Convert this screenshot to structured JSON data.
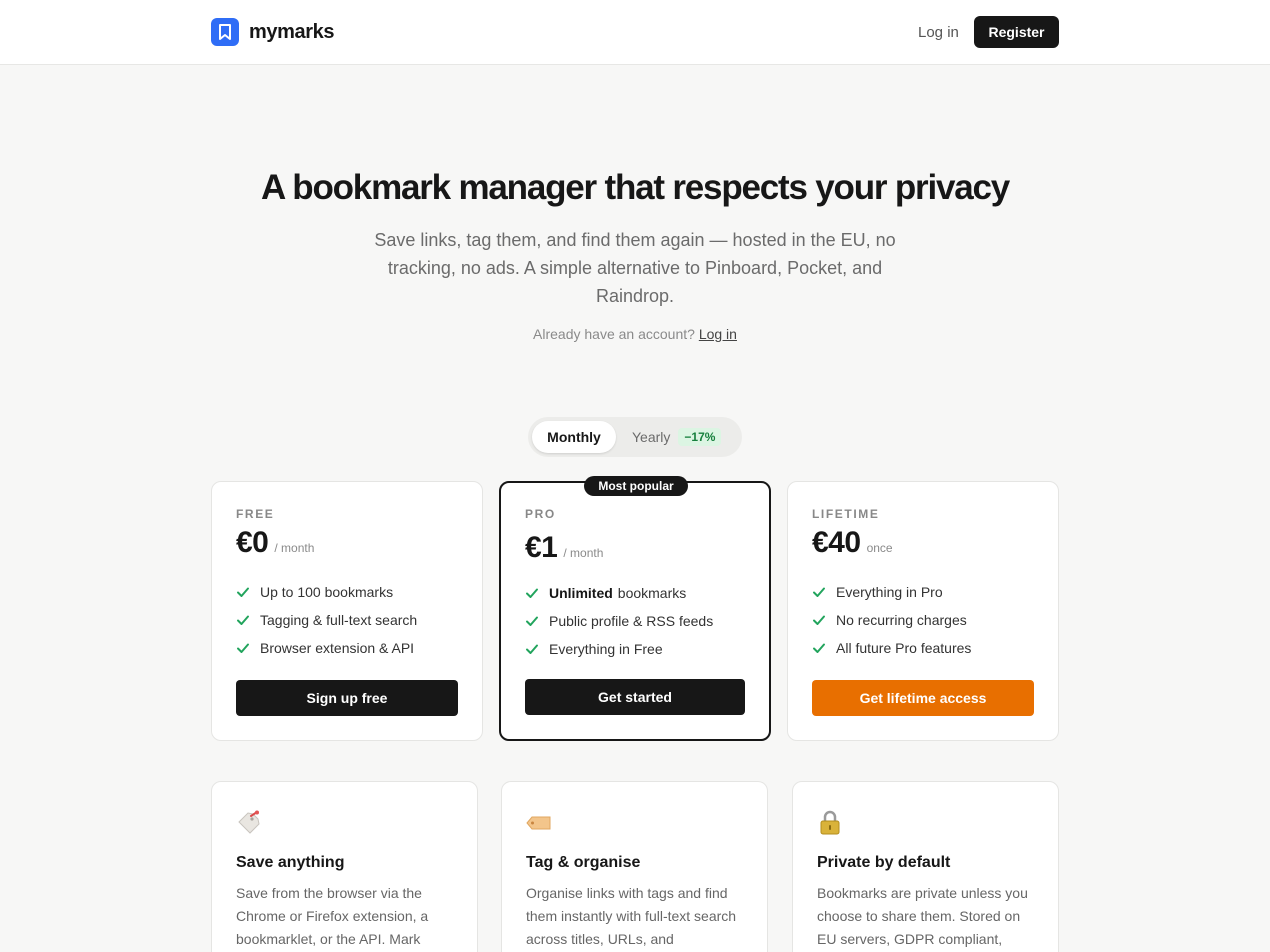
{
  "header": {
    "brand": "mymarks",
    "login_label": "Log in",
    "register_label": "Register"
  },
  "hero": {
    "title": "A bookmark manager that respects your privacy",
    "subtitle": "Save links, tag them, and find them again — hosted in the EU, no tracking, no ads. A simple alternative to Pinboard, Pocket, and Raindrop.",
    "account_prompt": "Already have an account?",
    "account_link": "Log in"
  },
  "billing": {
    "monthly_label": "Monthly",
    "yearly_label": "Yearly",
    "yearly_discount": "−17%",
    "selected": "Monthly"
  },
  "plans": [
    {
      "name": "FREE",
      "price": "€0",
      "period": "/ month",
      "features": [
        "Up to 100 bookmarks",
        "Tagging & full-text search",
        "Browser extension & API"
      ],
      "cta": "Sign up free"
    },
    {
      "name": "PRO",
      "badge": "Most popular",
      "price": "€1",
      "period": "/ month",
      "features_bold": "Unlimited",
      "features": [
        "bookmarks",
        "Public profile & RSS feeds",
        "Everything in Free"
      ],
      "cta": "Get started"
    },
    {
      "name": "LIFETIME",
      "price": "€40",
      "period": "once",
      "features": [
        "Everything in Pro",
        "No recurring charges",
        "All future Pro features"
      ],
      "cta": "Get lifetime access"
    }
  ],
  "feature_cards": [
    {
      "icon": "tag-pin-icon",
      "title": "Save anything",
      "text": "Save from the browser via the Chrome or Firefox extension, a bookmarklet, or the API. Mark"
    },
    {
      "icon": "label-icon",
      "title": "Tag & organise",
      "text": "Organise links with tags and find them instantly with full-text search across titles, URLs, and"
    },
    {
      "icon": "lock-icon",
      "title": "Private by default",
      "text": "Bookmarks are private unless you choose to share them. Stored on EU servers, GDPR compliant,"
    }
  ],
  "colors": {
    "brand_blue": "#2f6df6",
    "dark": "#171717",
    "accent_orange": "#e86f00",
    "check_green": "#22a45d",
    "discount_bg": "#dcf5e3",
    "discount_text": "#17803d"
  }
}
